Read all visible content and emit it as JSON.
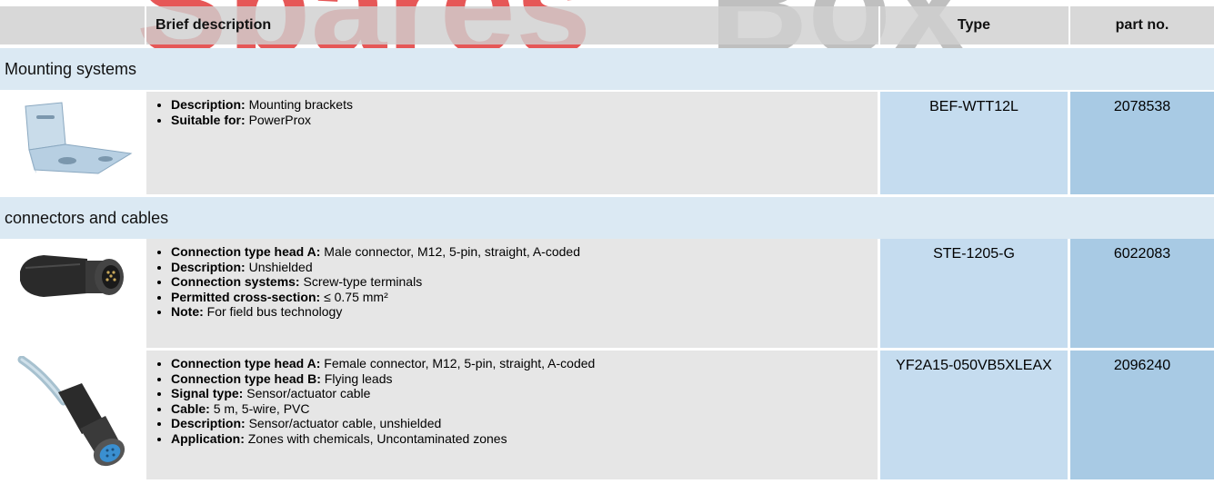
{
  "watermark": "SparesBox",
  "header": {
    "brief_description": "Brief description",
    "type": "Type",
    "part_no": "part no."
  },
  "sections": [
    {
      "title": "Mounting systems",
      "items": [
        {
          "image": "mounting-bracket-image",
          "bullets": [
            {
              "key": "Description:",
              "value": "Mounting brackets"
            },
            {
              "key": "Suitable for:",
              "value": "PowerProx"
            }
          ],
          "type": "BEF-WTT12L",
          "part_no": "2078538"
        }
      ]
    },
    {
      "title": "connectors and cables",
      "items": [
        {
          "image": "male-connector-image",
          "bullets": [
            {
              "key": "Connection type head A:",
              "value": "Male connector, M12, 5-pin, straight, A-coded"
            },
            {
              "key": "Description:",
              "value": "Unshielded"
            },
            {
              "key": "Connection systems:",
              "value": "Screw-type terminals"
            },
            {
              "key": "Permitted cross-section:",
              "value": "≤ 0.75 mm²"
            },
            {
              "key": "Note:",
              "value": "For field bus technology"
            }
          ],
          "type": "STE-1205-G",
          "part_no": "6022083"
        },
        {
          "image": "female-cable-image",
          "bullets": [
            {
              "key": "Connection type head A:",
              "value": "Female connector, M12, 5-pin, straight, A-coded"
            },
            {
              "key": "Connection type head B:",
              "value": "Flying leads"
            },
            {
              "key": "Signal type:",
              "value": "Sensor/actuator cable"
            },
            {
              "key": "Cable:",
              "value": "5 m, 5-wire, PVC"
            },
            {
              "key": "Description:",
              "value": "Sensor/actuator cable, unshielded"
            },
            {
              "key": "Application:",
              "value": "Zones with chemicals, Uncontaminated zones"
            }
          ],
          "type": "YF2A15-050VB5XLEAX",
          "part_no": "2096240"
        }
      ]
    }
  ],
  "colors": {
    "header_bg": "#d0d0d0",
    "section_bg": "#dbe9f3",
    "desc_bg": "#e6e6e6",
    "type_bg": "#c5dcef",
    "part_bg": "#a8cae4",
    "watermark_red": "#e23a3a",
    "watermark_grey": "#8a8a8a"
  }
}
